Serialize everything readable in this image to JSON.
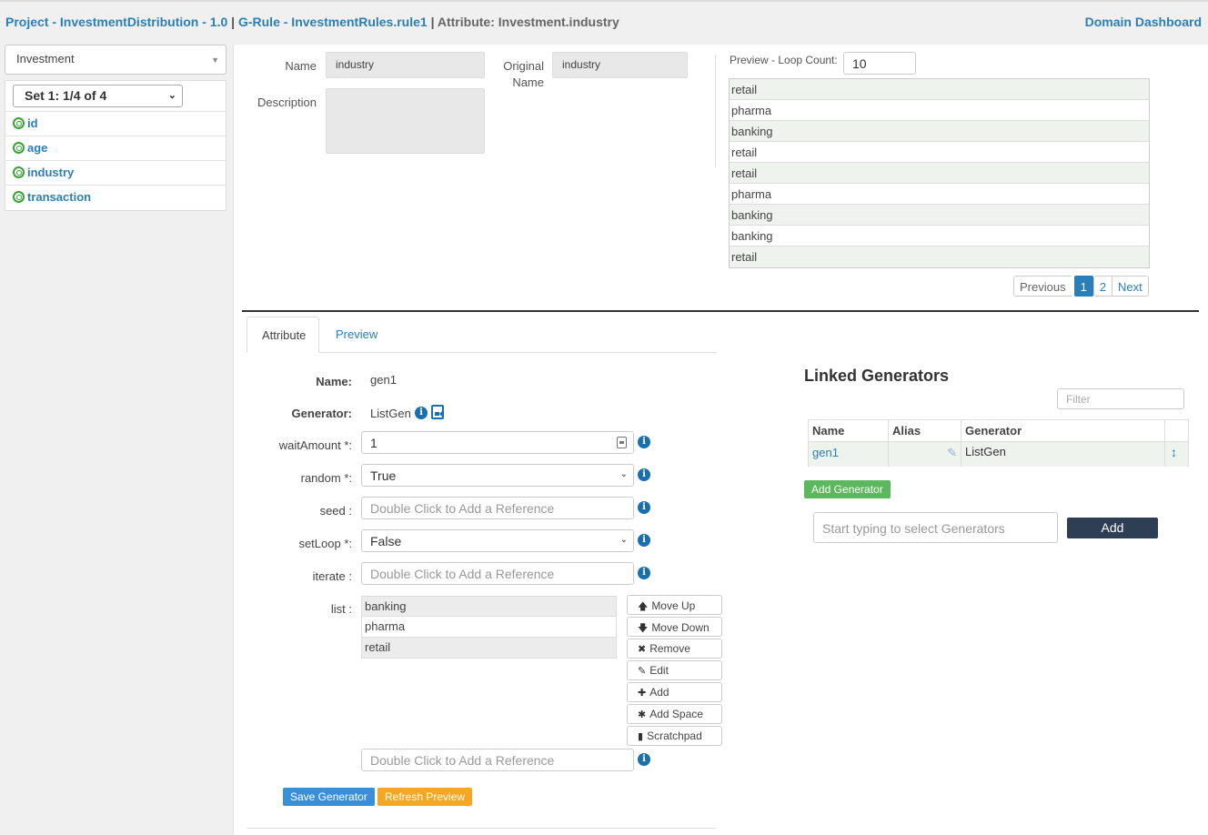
{
  "header": {
    "crumb_project": "Project - InvestmentDistribution - 1.0",
    "crumb_sep1": " | ",
    "crumb_rule": "G-Rule - InvestmentRules.rule1",
    "crumb_sep2": " | ",
    "crumb_attribute": "Attribute: Investment.industry",
    "domain_link": "Domain Dashboard"
  },
  "sidebar": {
    "entity_selected": "Investment",
    "set_selected": "Set 1: 1/4 of 4",
    "attributes": [
      {
        "label": "id"
      },
      {
        "label": "age"
      },
      {
        "label": "industry"
      },
      {
        "label": "transaction"
      }
    ]
  },
  "details": {
    "name_label": "Name",
    "name_value": "industry",
    "original_label_1": "Original",
    "original_label_2": "Name",
    "original_value": "industry",
    "description_label": "Description",
    "description_value": ""
  },
  "preview": {
    "loop_label": "Preview - Loop Count:",
    "loop_count": "10",
    "rows": [
      "retail",
      "pharma",
      "banking",
      "retail",
      "retail",
      "pharma",
      "banking",
      "banking",
      "retail"
    ],
    "pager": {
      "previous": "Previous",
      "page1": "1",
      "page2": "2",
      "next": "Next",
      "current_page": 1
    }
  },
  "tabs": [
    {
      "label": "Attribute",
      "active": true
    },
    {
      "label": "Preview",
      "active": false
    }
  ],
  "form": {
    "name_label": "Name:",
    "name_value": "gen1",
    "generator_label": "Generator:",
    "generator_value": "ListGen",
    "wait_label": "waitAmount *:",
    "wait_value": "1",
    "random_label": "random *:",
    "random_value": "True",
    "seed_label": "seed :",
    "seed_placeholder": "Double Click to Add a Reference",
    "setloop_label": "setLoop *:",
    "setloop_value": "False",
    "iterate_label": "iterate :",
    "iterate_placeholder": "Double Click to Add a Reference",
    "list_label": "list :",
    "list_items": [
      "banking",
      "pharma",
      "retail"
    ],
    "list_ref_placeholder": "Double Click to Add a Reference",
    "list_buttons": {
      "move_up": "Move Up",
      "move_down": "Move Down",
      "remove": "Remove",
      "edit": "Edit",
      "add": "Add",
      "add_space": "Add Space",
      "scratchpad": "Scratchpad"
    },
    "save_button": "Save Generator",
    "refresh_button": "Refresh Preview",
    "save_color": "#3a8fd8",
    "refresh_color": "#f5a623"
  },
  "linked": {
    "title": "Linked Generators",
    "filter_placeholder": "Filter",
    "columns": [
      "Name",
      "Alias",
      "Generator"
    ],
    "rows": [
      {
        "name": "gen1",
        "alias": "",
        "generator": "ListGen"
      }
    ],
    "add_generator_button": "Add Generator",
    "add_generator_color": "#5cb85c",
    "search_placeholder": "Start typing to select Generators",
    "add_button": "Add"
  }
}
